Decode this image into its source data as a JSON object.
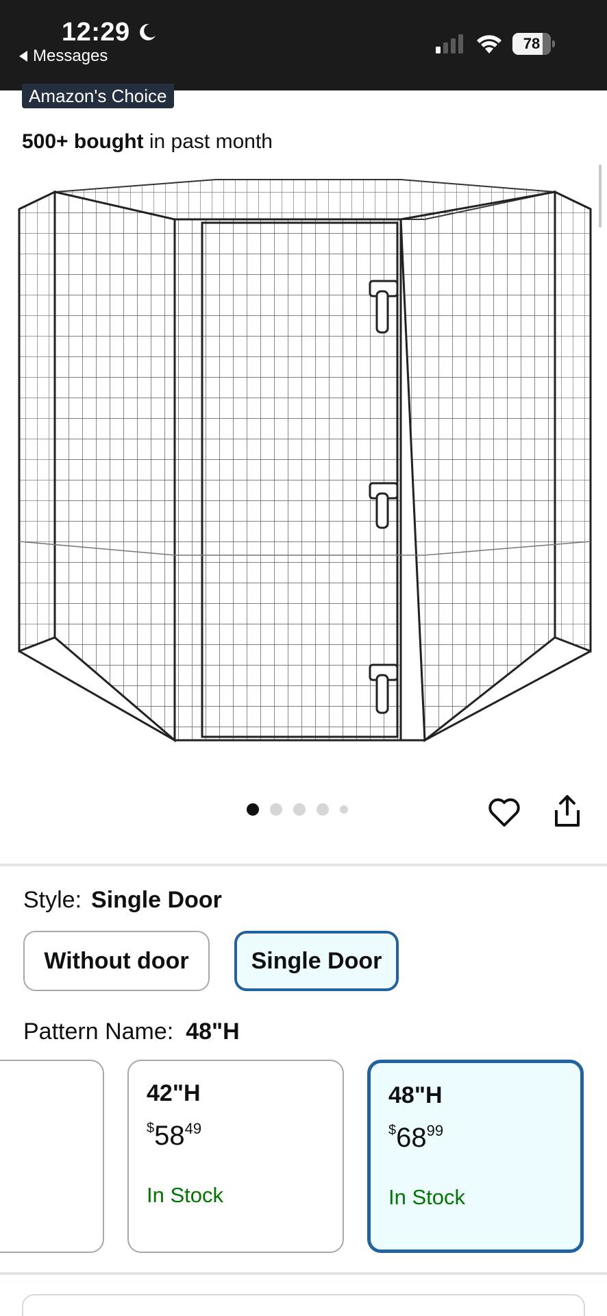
{
  "status_bar": {
    "time": "12:29",
    "back_app": "Messages",
    "battery": "78"
  },
  "product": {
    "badge": "Amazon's Choice",
    "bought_bold": "500+ bought",
    "bought_rest": " in past month",
    "carousel_total": 5,
    "carousel_active": 1
  },
  "style": {
    "label": "Style:",
    "selected_value": "Single Door",
    "options": [
      {
        "label": "Without door",
        "selected": false
      },
      {
        "label": "Single Door",
        "selected": true
      }
    ]
  },
  "pattern": {
    "label": "Pattern Name:",
    "selected_value": "48\"H",
    "options": [
      {
        "title": "42\"H",
        "currency": "$",
        "dollars": "58",
        "cents": "49",
        "stock": "In Stock",
        "selected": false
      },
      {
        "title": "48\"H",
        "currency": "$",
        "dollars": "68",
        "cents": "99",
        "stock": "In Stock",
        "selected": true
      }
    ]
  },
  "colors": {
    "accent": "#2162a1",
    "selected_bg": "#edfdff",
    "in_stock": "#007600",
    "badge_bg": "#232f3e"
  }
}
